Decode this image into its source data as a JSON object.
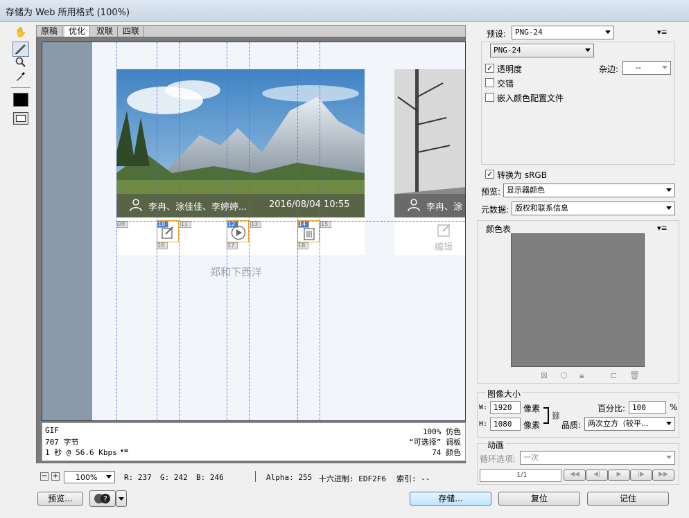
{
  "window": {
    "title": "存储为 Web 所用格式 (100%)"
  },
  "tools": [
    "hand-icon",
    "slice-select-icon",
    "zoom-icon",
    "eyedropper-icon",
    "color-swatch-icon",
    "toggle-slices-icon"
  ],
  "tabs": [
    {
      "label": "原稿"
    },
    {
      "label": "优化"
    },
    {
      "label": "双联"
    },
    {
      "label": "四联"
    }
  ],
  "preview": {
    "card1_caption": "李冉、涂佳佳、李婷婷...",
    "card1_time": "2016/08/04 10:55",
    "card2_caption": "李冉、涂",
    "edit_label": "编辑",
    "group_name": "郑和下西洋",
    "slice_numbers": [
      "09",
      "10",
      "11",
      "12",
      "13",
      "14",
      "15",
      "16",
      "17",
      "18"
    ]
  },
  "info": {
    "format": "GIF",
    "size": "707 字节",
    "speed": "1 秒 @ 56.6 Kbps",
    "dither": "100% 仿色",
    "palette": "“可选择” 调板",
    "colors": "74 颜色"
  },
  "statusbar": {
    "zoom": "100%",
    "r": "R: 237",
    "g": "G: 242",
    "b": "B: 246",
    "alpha": "Alpha: 255",
    "hex": "十六进制: EDF2F6",
    "index": "索引: --"
  },
  "buttons": {
    "preview": "预览...",
    "save": "存储...",
    "reset": "复位",
    "remember": "记住"
  },
  "settings": {
    "preset_label": "预设:",
    "preset_value": "PNG-24",
    "format_value": "PNG-24",
    "transparency_label": "透明度",
    "transparency_checked": true,
    "matte_label": "杂边:",
    "matte_value": "--",
    "interlaced_label": "交错",
    "embed_profile_label": "嵌入颜色配置文件",
    "convert_srgb_label": "转换为 sRGB",
    "convert_srgb_checked": true,
    "preview_label": "预览:",
    "preview_value": "显示器颜色",
    "metadata_label": "元数据:",
    "metadata_value": "版权和联系信息"
  },
  "color_table": {
    "title": "颜色表",
    "bg_color": "#7f7f7f"
  },
  "image_size": {
    "title": "图像大小",
    "w_label": "W:",
    "w_value": "1920",
    "h_label": "H:",
    "h_value": "1080",
    "unit": "像素",
    "percent_label": "百分比:",
    "percent_value": "100",
    "percent_unit": "%",
    "quality_label": "品质:",
    "quality_value": "两次立方（较平..."
  },
  "animation": {
    "title": "动画",
    "loop_label": "循环选项:",
    "loop_value": "一次",
    "frame_counter": "1/1"
  }
}
